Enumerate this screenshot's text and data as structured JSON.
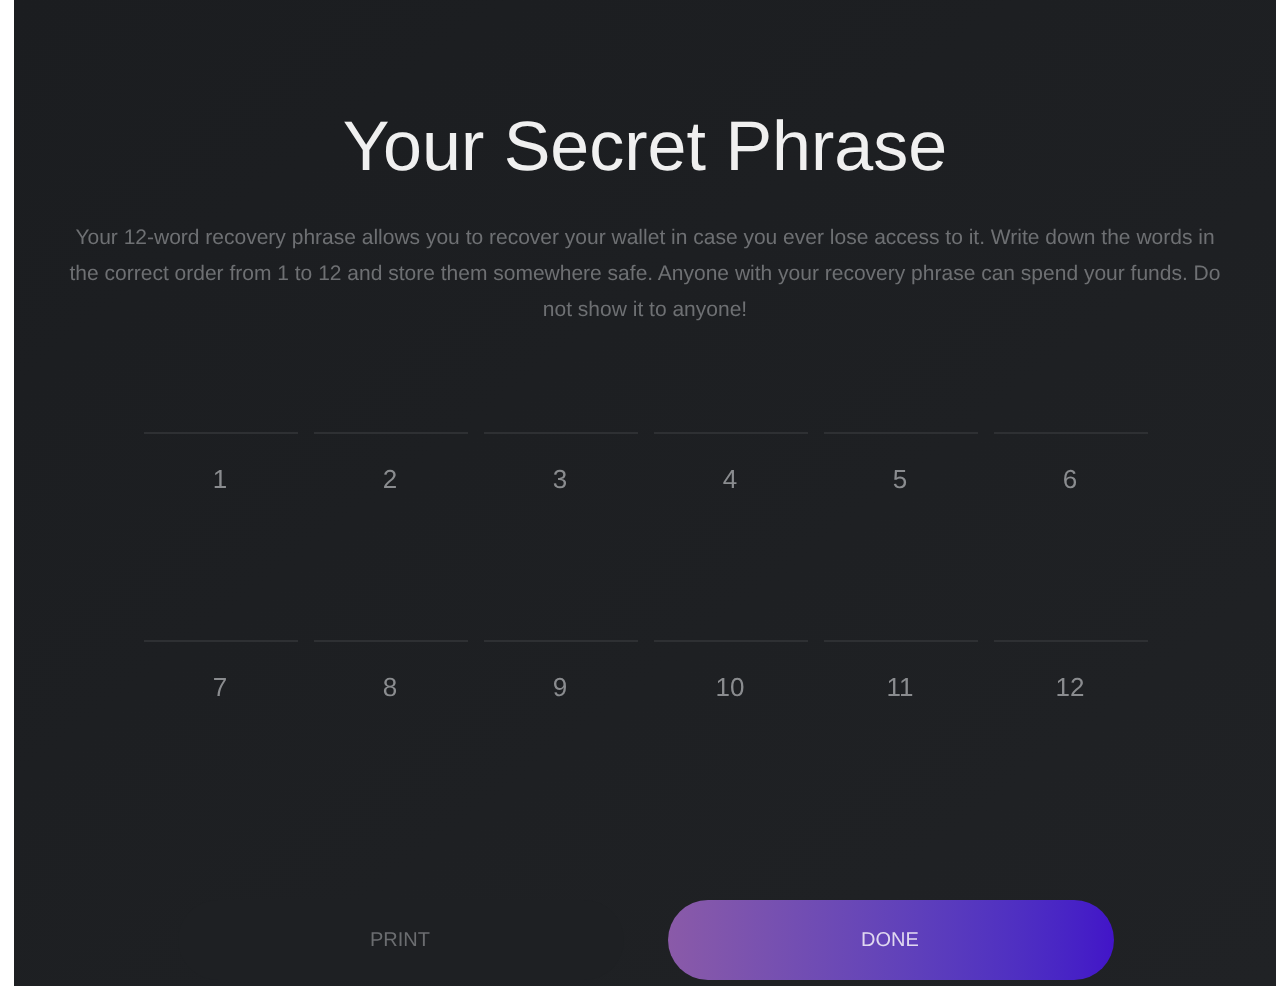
{
  "title": "Your Secret Phrase",
  "description": "Your 12-word recovery phrase allows you to recover your wallet in case you ever lose access to it. Write down the words in the correct order from 1 to 12 and store them somewhere safe. Anyone with your recovery phrase can spend your funds. Do not show it to anyone!",
  "word_slots": [
    "1",
    "2",
    "3",
    "4",
    "5",
    "6",
    "7",
    "8",
    "9",
    "10",
    "11",
    "12"
  ],
  "buttons": [
    {
      "label": "PRINT",
      "kind": "secondary"
    },
    {
      "label": "DONE",
      "kind": "primary"
    }
  ]
}
